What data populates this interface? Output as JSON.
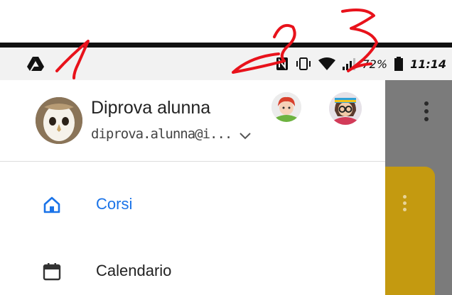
{
  "status_bar": {
    "left_icon": "drive-icon",
    "battery": "72%",
    "time": "11:14"
  },
  "account": {
    "name": "Diprova alunna",
    "email": "diprova.alunna@i..."
  },
  "nav": {
    "items": [
      {
        "label": "Corsi",
        "icon": "home-icon",
        "active": true
      },
      {
        "label": "Calendario",
        "icon": "calendar-icon",
        "active": false
      }
    ]
  },
  "annotations": [
    "1",
    "2",
    "3"
  ],
  "colors": {
    "accent": "#1a73e8",
    "annotation": "#e8121b",
    "scrim": "#7b7b7b"
  }
}
